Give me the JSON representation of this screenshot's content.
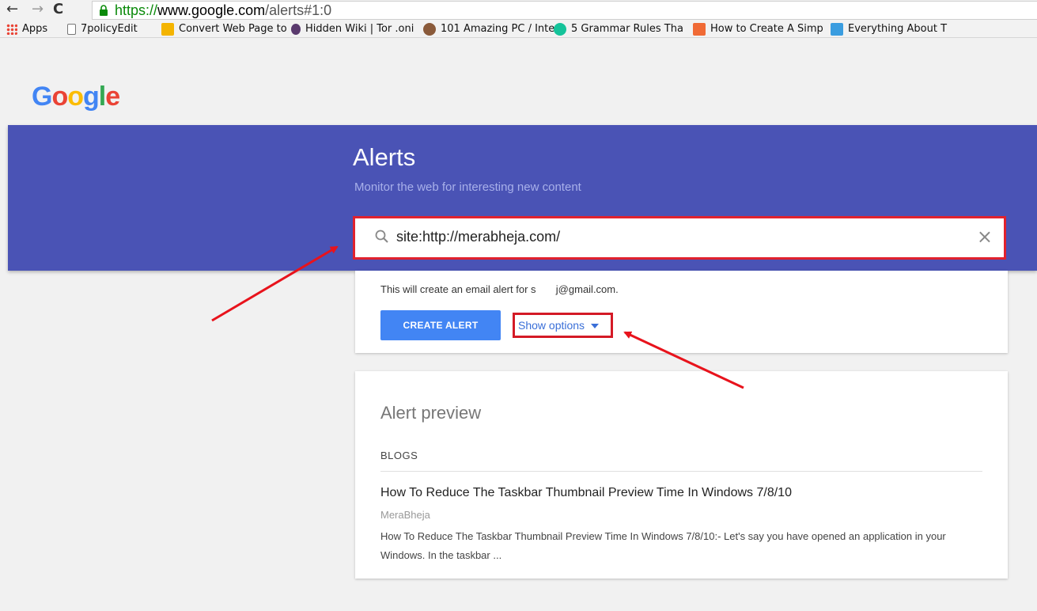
{
  "browser": {
    "url_scheme": "https://",
    "url_host": "www.google.com",
    "url_path": "/alerts#1:0"
  },
  "bookmarks": [
    {
      "label": "Apps",
      "icon": "apps-grid-icon",
      "color": "#e94335"
    },
    {
      "label": "7policyEdit",
      "icon": "document-icon",
      "color": "#777777"
    },
    {
      "label": "Convert Web Page to",
      "icon": "folder-icon",
      "color": "#f4b400"
    },
    {
      "label": "Hidden Wiki | Tor .oni",
      "icon": "onion-icon",
      "color": "#5a3a6e"
    },
    {
      "label": "101 Amazing PC / Inte",
      "icon": "avatar-icon",
      "color": "#8a5a3a"
    },
    {
      "label": "5 Grammar Rules Tha",
      "icon": "grammarly-icon",
      "color": "#15c39a"
    },
    {
      "label": "How to Create A Simp",
      "icon": "plus-icon",
      "color": "#f06a35"
    },
    {
      "label": "Everything About T",
      "icon": "b-icon",
      "color": "#3a9de0"
    }
  ],
  "logo": {
    "text": "Google"
  },
  "hero": {
    "title": "Alerts",
    "subtitle": "Monitor the web for interesting new content"
  },
  "search": {
    "value": "site:http://merabheja.com/"
  },
  "alert_card": {
    "info_text": "This will create an email alert for s       j@gmail.com.",
    "create_label": "CREATE ALERT",
    "options_label": "Show options"
  },
  "preview": {
    "title": "Alert preview",
    "category": "BLOGS",
    "result_title": "How To Reduce The Taskbar Thumbnail Preview Time In Windows 7/8/10",
    "result_source": "MeraBheja",
    "result_snippet": "How To Reduce The Taskbar Thumbnail Preview Time In Windows 7/8/10:- Let's say you have opened an application in your Windows. In the taskbar ..."
  },
  "colors": {
    "hero": "#4a53b5",
    "highlight": "#e0222e",
    "button": "#4285f4"
  }
}
